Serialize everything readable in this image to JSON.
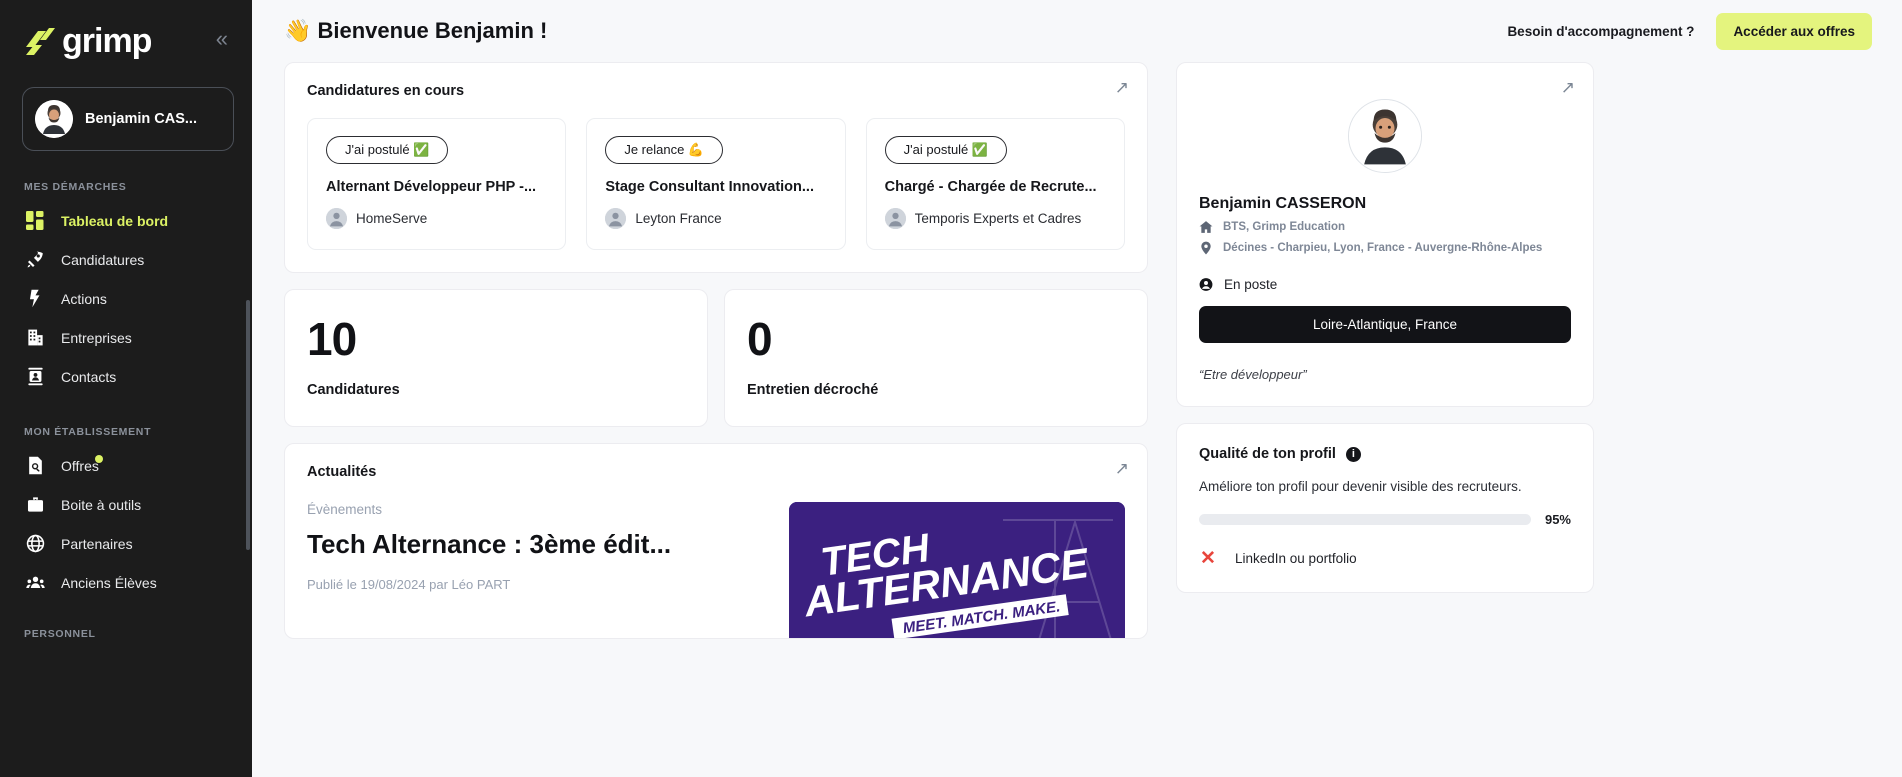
{
  "sidebar": {
    "brand": "grimp",
    "collapse_icon": "chevron-double-left-icon",
    "user": {
      "name": "Benjamin CAS...",
      "avatar_icon": "avatar-icon"
    },
    "groups": [
      {
        "title": "MES DÉMARCHES",
        "items": [
          {
            "label": "Tableau de bord",
            "icon": "dashboard-icon",
            "active": true
          },
          {
            "label": "Candidatures",
            "icon": "rocket-icon",
            "active": false
          },
          {
            "label": "Actions",
            "icon": "bolt-icon",
            "active": false
          },
          {
            "label": "Entreprises",
            "icon": "building-icon",
            "active": false
          },
          {
            "label": "Contacts",
            "icon": "contact-card-icon",
            "active": false
          }
        ]
      },
      {
        "title": "MON ÉTABLISSEMENT",
        "items": [
          {
            "label": "Offres",
            "icon": "document-search-icon",
            "active": false,
            "badge": true
          },
          {
            "label": "Boite à outils",
            "icon": "briefcase-icon",
            "active": false
          },
          {
            "label": "Partenaires",
            "icon": "globe-icon",
            "active": false
          },
          {
            "label": "Anciens Élèves",
            "icon": "people-group-icon",
            "active": false
          }
        ]
      }
    ],
    "bottom_group_title": "PERSONNEL"
  },
  "header": {
    "title": "👋 Bienvenue Benjamin !",
    "help_label": "Besoin d'accompagnement ?",
    "cta_label": "Accéder aux offres"
  },
  "applications": {
    "title": "Candidatures en cours",
    "expand_icon": "expand-arrow-icon",
    "items": [
      {
        "status": "J'ai postulé ✅",
        "role": "Alternant Développeur PHP -...",
        "company": "HomeServe"
      },
      {
        "status": "Je relance 💪",
        "role": "Stage Consultant Innovation...",
        "company": "Leyton France"
      },
      {
        "status": "J'ai postulé ✅",
        "role": "Chargé - Chargée de Recrute...",
        "company": "Temporis Experts et Cadres"
      }
    ]
  },
  "stats": [
    {
      "value": "10",
      "label": "Candidatures"
    },
    {
      "value": "0",
      "label": "Entretien décroché"
    }
  ],
  "news": {
    "title": "Actualités",
    "expand_icon": "expand-arrow-icon",
    "category": "Évènements",
    "headline": "Tech Alternance : 3ème édit...",
    "meta": "Publié le 19/08/2024 par Léo PART",
    "thumb": {
      "line1": "TECH",
      "line2": "ALTERNANCE",
      "tagline": "MEET. MATCH. MAKE.",
      "bg_color": "#3b2080"
    }
  },
  "profile": {
    "expand_icon": "expand-arrow-icon",
    "avatar_icon": "user-photo-icon",
    "name": "Benjamin CASSERON",
    "school": "BTS, Grimp Education",
    "school_icon": "home-icon",
    "location": "Décines - Charpieu, Lyon, France - Auvergne-Rhône-Alpes",
    "location_icon": "map-pin-icon",
    "status": "En poste",
    "status_icon": "person-circle-icon",
    "region_button": "Loire-Atlantique, France",
    "quote": "“Etre développeur”"
  },
  "quality": {
    "title": "Qualité de ton profil",
    "info_icon": "info-icon",
    "subtitle": "Améliore ton profil pour devenir visible des recruteurs.",
    "percent_label": "95%",
    "percent_value": 95,
    "bar_color": "#dff06a",
    "todos": [
      {
        "icon": "close-x-icon",
        "label": "LinkedIn ou portfolio"
      }
    ]
  }
}
